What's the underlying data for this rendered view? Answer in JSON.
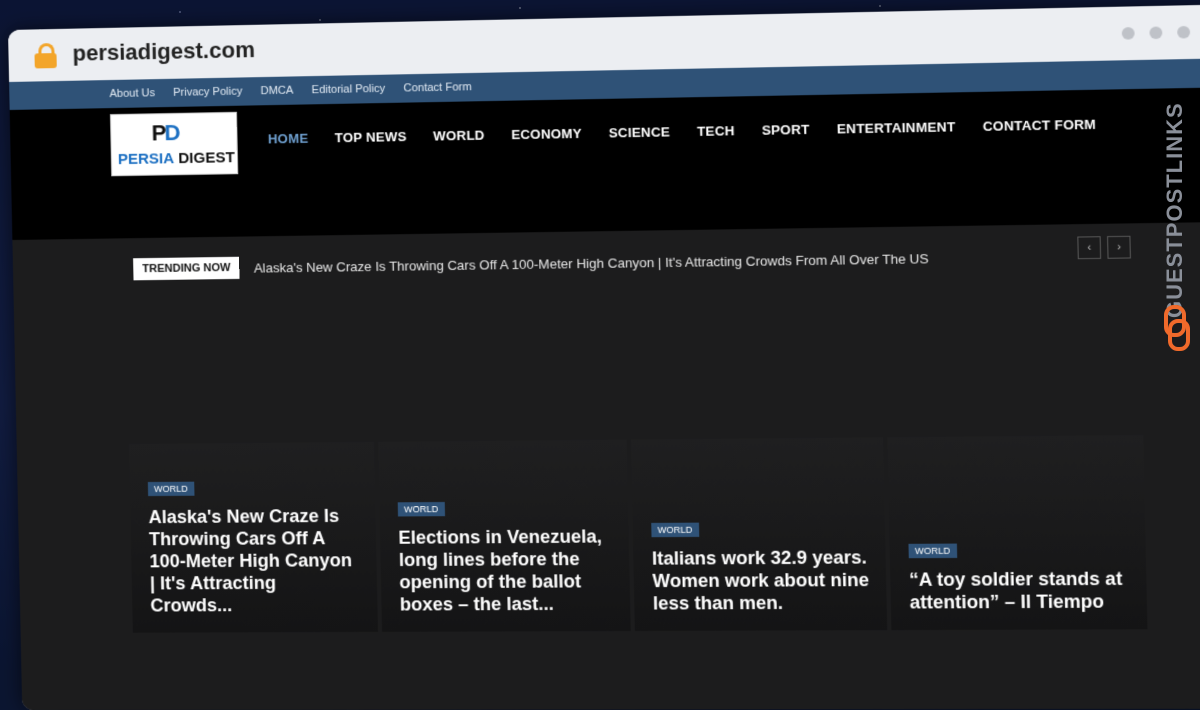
{
  "browser": {
    "url": "persiadigest.com"
  },
  "topbar": {
    "links": [
      "About Us",
      "Privacy Policy",
      "DMCA",
      "Editorial Policy",
      "Contact Form"
    ]
  },
  "logo": {
    "mark_a": "P",
    "mark_b": "D",
    "name_a": "PERSIA",
    "name_b": " DIGEST"
  },
  "nav": {
    "items": [
      "HOME",
      "TOP NEWS",
      "WORLD",
      "ECONOMY",
      "SCIENCE",
      "TECH",
      "SPORT",
      "ENTERTAINMENT",
      "CONTACT FORM"
    ],
    "active": "HOME"
  },
  "trending": {
    "label": "TRENDING NOW",
    "text": "Alaska's New Craze Is Throwing Cars Off A 100-Meter High Canyon | It's Attracting Crowds From All Over The US",
    "prev": "‹",
    "next": "›"
  },
  "cards": [
    {
      "category": "WORLD",
      "title": "Alaska's New Craze Is Throwing Cars Off A 100-Meter High Canyon | It's Attracting Crowds..."
    },
    {
      "category": "WORLD",
      "title": "Elections in Venezuela, long lines before the opening of the ballot boxes – the last..."
    },
    {
      "category": "WORLD",
      "title": "Italians work 32.9 years. Women work about nine less than men."
    },
    {
      "category": "WORLD",
      "title": "“A toy soldier stands at attention” – Il Tiempo"
    }
  ],
  "watermark": {
    "text": "GUESTPOSTLINKS"
  },
  "colors": {
    "accent": "#2f5277",
    "nav_active": "#6fa0d0",
    "lock": "#f3a52a",
    "brand_orange": "#f06a2b"
  }
}
